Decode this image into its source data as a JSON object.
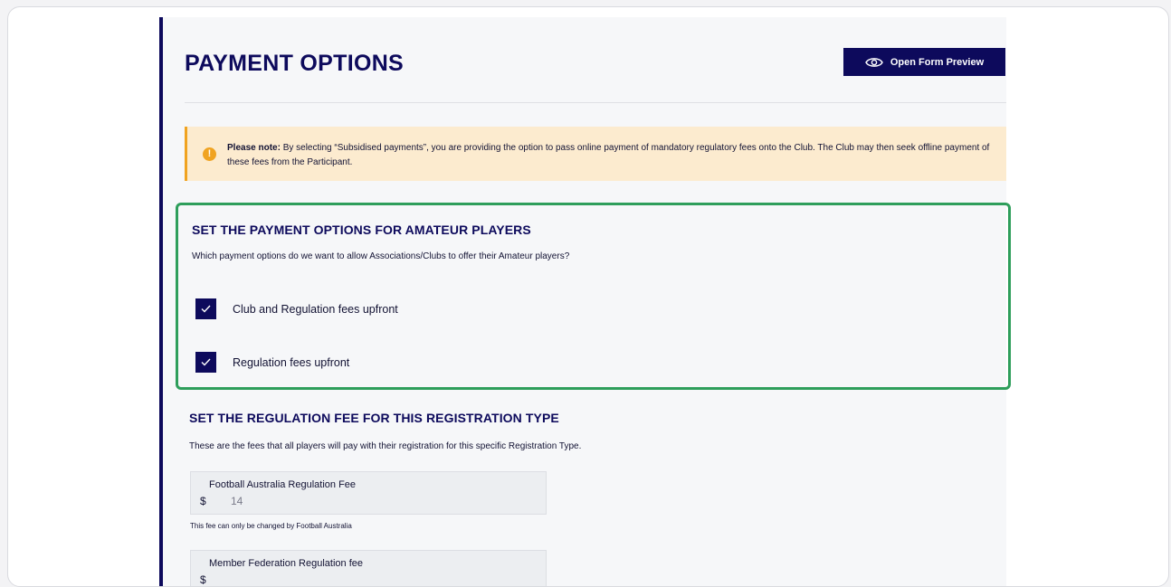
{
  "page": {
    "title": "PAYMENT OPTIONS",
    "preview_button": "Open Form Preview"
  },
  "note": {
    "bold": "Please note:",
    "text": "By selecting “Subsidised payments”, you are providing the option to pass online payment of mandatory regulatory fees onto the Club. The Club may then seek offline payment of these fees from the Participant.",
    "icon": "warning-icon"
  },
  "amateur": {
    "title": "SET THE PAYMENT OPTIONS FOR AMATEUR PLAYERS",
    "description": "Which payment options do we want to allow Associations/Clubs to offer their Amateur players?",
    "options": [
      {
        "label": "Club and Regulation fees upfront",
        "checked": true
      },
      {
        "label": "Regulation fees upfront",
        "checked": true
      }
    ]
  },
  "regulation": {
    "title": "SET THE REGULATION FEE FOR THIS REGISTRATION TYPE",
    "description": "These are the fees that all players will pay with their registration for this specific Registration Type.",
    "fields": [
      {
        "label": "Football Australia Regulation Fee",
        "currency": "$",
        "value": "14",
        "help": "This fee can only be changed by Football Australia"
      },
      {
        "label": "Member Federation Regulation fee",
        "currency": "$",
        "value": ""
      }
    ]
  },
  "colors": {
    "navy": "#0d0a5c",
    "warning": "#f0a321",
    "highlight": "#2e9e5b"
  }
}
